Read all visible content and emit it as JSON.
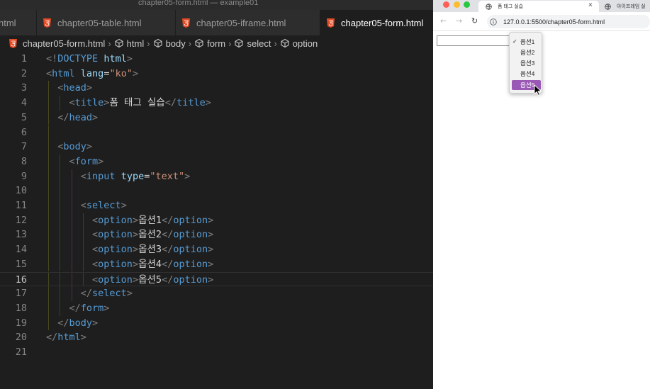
{
  "editor": {
    "window_title": "chapter05-form.html — example01",
    "tabs": [
      {
        "label": "html",
        "active": false
      },
      {
        "label": "chapter05-table.html",
        "active": false
      },
      {
        "label": "chapter05-iframe.html",
        "active": false
      },
      {
        "label": "chapter05-form.html",
        "active": true
      }
    ],
    "breadcrumb": [
      "chapter05-form.html",
      "html",
      "body",
      "form",
      "select",
      "option"
    ],
    "current_line": 16,
    "lines": [
      {
        "n": "1",
        "tokens": [
          [
            "tg",
            "<!"
          ],
          [
            "tn",
            "DOCTYPE"
          ],
          [
            "tx",
            " "
          ],
          [
            "at",
            "html"
          ],
          [
            "tg",
            ">"
          ]
        ]
      },
      {
        "n": "2",
        "tokens": [
          [
            "tg",
            "<"
          ],
          [
            "tn",
            "html"
          ],
          [
            "tx",
            " "
          ],
          [
            "at",
            "lang"
          ],
          [
            "tx",
            "="
          ],
          [
            "av",
            "\"ko\""
          ],
          [
            "tg",
            ">"
          ]
        ]
      },
      {
        "n": "3",
        "tokens": [
          [
            "tx",
            "  "
          ],
          [
            "tg",
            "<"
          ],
          [
            "tn",
            "head"
          ],
          [
            "tg",
            ">"
          ]
        ]
      },
      {
        "n": "4",
        "tokens": [
          [
            "tx",
            "    "
          ],
          [
            "tg",
            "<"
          ],
          [
            "tn",
            "title"
          ],
          [
            "tg",
            ">"
          ],
          [
            "tx",
            "폼 태그 실습"
          ],
          [
            "tg",
            "</"
          ],
          [
            "tn",
            "title"
          ],
          [
            "tg",
            ">"
          ]
        ]
      },
      {
        "n": "5",
        "tokens": [
          [
            "tx",
            "  "
          ],
          [
            "tg",
            "</"
          ],
          [
            "tn",
            "head"
          ],
          [
            "tg",
            ">"
          ]
        ]
      },
      {
        "n": "6",
        "tokens": []
      },
      {
        "n": "7",
        "tokens": [
          [
            "tx",
            "  "
          ],
          [
            "tg",
            "<"
          ],
          [
            "tn",
            "body"
          ],
          [
            "tg",
            ">"
          ]
        ]
      },
      {
        "n": "8",
        "tokens": [
          [
            "tx",
            "    "
          ],
          [
            "tg",
            "<"
          ],
          [
            "tn",
            "form"
          ],
          [
            "tg",
            ">"
          ]
        ]
      },
      {
        "n": "9",
        "tokens": [
          [
            "tx",
            "      "
          ],
          [
            "tg",
            "<"
          ],
          [
            "tn",
            "input"
          ],
          [
            "tx",
            " "
          ],
          [
            "at",
            "type"
          ],
          [
            "tx",
            "="
          ],
          [
            "av",
            "\"text\""
          ],
          [
            "tg",
            ">"
          ]
        ]
      },
      {
        "n": "10",
        "tokens": []
      },
      {
        "n": "11",
        "tokens": [
          [
            "tx",
            "      "
          ],
          [
            "tg",
            "<"
          ],
          [
            "tn",
            "select"
          ],
          [
            "tg",
            ">"
          ]
        ]
      },
      {
        "n": "12",
        "tokens": [
          [
            "tx",
            "        "
          ],
          [
            "tg",
            "<"
          ],
          [
            "tn",
            "option"
          ],
          [
            "tg",
            ">"
          ],
          [
            "tx",
            "옵션1"
          ],
          [
            "tg",
            "</"
          ],
          [
            "tn",
            "option"
          ],
          [
            "tg",
            ">"
          ]
        ]
      },
      {
        "n": "13",
        "tokens": [
          [
            "tx",
            "        "
          ],
          [
            "tg",
            "<"
          ],
          [
            "tn",
            "option"
          ],
          [
            "tg",
            ">"
          ],
          [
            "tx",
            "옵션2"
          ],
          [
            "tg",
            "</"
          ],
          [
            "tn",
            "option"
          ],
          [
            "tg",
            ">"
          ]
        ]
      },
      {
        "n": "14",
        "tokens": [
          [
            "tx",
            "        "
          ],
          [
            "tg",
            "<"
          ],
          [
            "tn",
            "option"
          ],
          [
            "tg",
            ">"
          ],
          [
            "tx",
            "옵션3"
          ],
          [
            "tg",
            "</"
          ],
          [
            "tn",
            "option"
          ],
          [
            "tg",
            ">"
          ]
        ]
      },
      {
        "n": "15",
        "tokens": [
          [
            "tx",
            "        "
          ],
          [
            "tg",
            "<"
          ],
          [
            "tn",
            "option"
          ],
          [
            "tg",
            ">"
          ],
          [
            "tx",
            "옵션4"
          ],
          [
            "tg",
            "</"
          ],
          [
            "tn",
            "option"
          ],
          [
            "tg",
            ">"
          ]
        ]
      },
      {
        "n": "16",
        "tokens": [
          [
            "tx",
            "        "
          ],
          [
            "tg",
            "<"
          ],
          [
            "tn",
            "option"
          ],
          [
            "tg",
            ">"
          ],
          [
            "tx",
            "옵션5"
          ],
          [
            "tg",
            "</"
          ],
          [
            "tn",
            "option"
          ],
          [
            "tg",
            ">"
          ]
        ]
      },
      {
        "n": "17",
        "tokens": [
          [
            "tx",
            "      "
          ],
          [
            "tg",
            "</"
          ],
          [
            "tn",
            "select"
          ],
          [
            "tg",
            ">"
          ]
        ]
      },
      {
        "n": "18",
        "tokens": [
          [
            "tx",
            "    "
          ],
          [
            "tg",
            "</"
          ],
          [
            "tn",
            "form"
          ],
          [
            "tg",
            ">"
          ]
        ]
      },
      {
        "n": "19",
        "tokens": [
          [
            "tx",
            "  "
          ],
          [
            "tg",
            "</"
          ],
          [
            "tn",
            "body"
          ],
          [
            "tg",
            ">"
          ]
        ]
      },
      {
        "n": "20",
        "tokens": [
          [
            "tg",
            "</"
          ],
          [
            "tn",
            "html"
          ],
          [
            "tg",
            ">"
          ]
        ]
      },
      {
        "n": "21",
        "tokens": []
      }
    ]
  },
  "browser": {
    "tabs": [
      {
        "label": "폼 태그 실습",
        "active": true,
        "icon": "globe-icon"
      },
      {
        "label": "아이프레임 실",
        "active": false,
        "icon": "globe-icon"
      }
    ],
    "tab_close": "×",
    "nav": {
      "back": "←",
      "forward": "→",
      "reload": "↻"
    },
    "url": "127.0.0.1:5500/chapter05-form.html",
    "page": {
      "text_input_value": "",
      "select_options": [
        "옵션1",
        "옵션2",
        "옵션3",
        "옵션4",
        "옵션5"
      ],
      "selected_index": 0,
      "highlighted_index": 4,
      "checkmark": "✓"
    }
  },
  "colors": {
    "editor_bg": "#1e1e1e",
    "tag_bracket": "#808080",
    "tag_name": "#569cd6",
    "attribute": "#9cdcfe",
    "string": "#ce9178",
    "html_file_icon": "#e34c26",
    "option_highlight": "#9b59b6"
  }
}
